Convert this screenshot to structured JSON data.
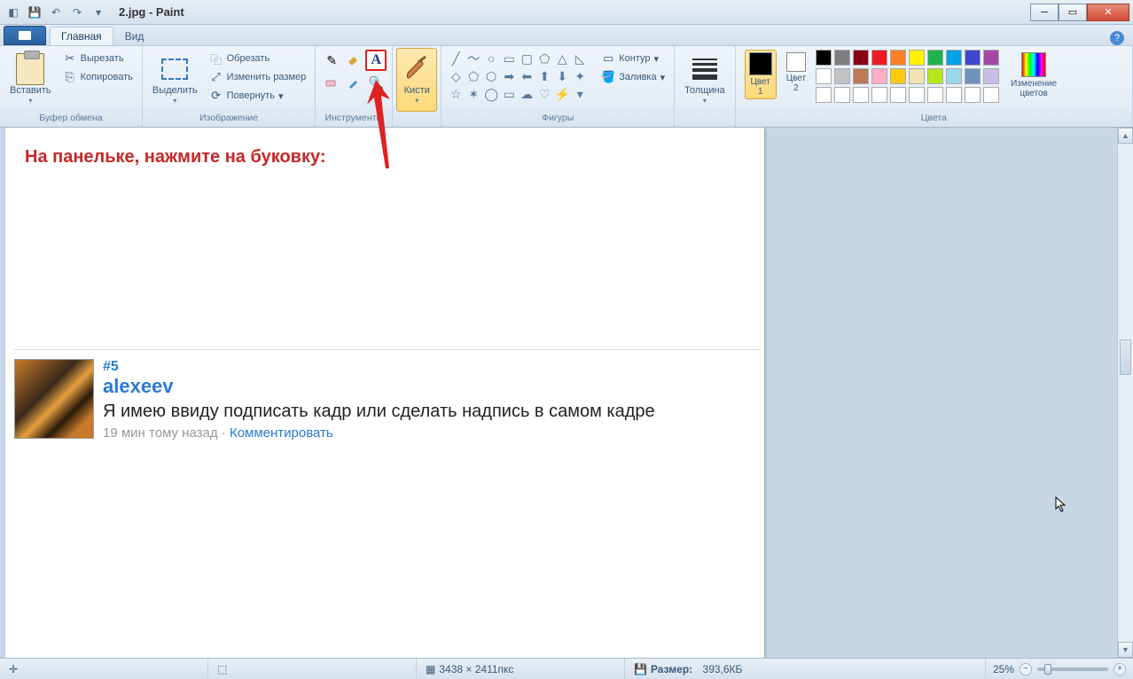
{
  "title": {
    "filename": "2.jpg",
    "app": "Paint"
  },
  "tabs": {
    "home": "Главная",
    "view": "Вид"
  },
  "ribbon": {
    "clipboard": {
      "paste": "Вставить",
      "cut": "Вырезать",
      "copy": "Копировать",
      "label": "Буфер обмена"
    },
    "image": {
      "select": "Выделить",
      "crop": "Обрезать",
      "resize": "Изменить размер",
      "rotate": "Повернуть",
      "label": "Изображение"
    },
    "tools": {
      "label": "Инструменты"
    },
    "brushes": {
      "label": "Кисти"
    },
    "shapes": {
      "outline": "Контур",
      "fill": "Заливка",
      "label": "Фигуры"
    },
    "thickness": {
      "label": "Толщина"
    },
    "colors": {
      "color1": "Цвет\n1",
      "color2": "Цвет\n2",
      "edit": "Изменение\nцветов",
      "label": "Цвета"
    }
  },
  "palette_row1": [
    "#000000",
    "#7f7f7f",
    "#880015",
    "#ed1c24",
    "#ff7f27",
    "#fff200",
    "#22b14c",
    "#00a2e8",
    "#3f48cc",
    "#a349a4"
  ],
  "palette_row2": [
    "#ffffff",
    "#c3c3c3",
    "#b97a57",
    "#ffaec9",
    "#ffc90e",
    "#efe4b0",
    "#b5e61d",
    "#99d9ea",
    "#7092be",
    "#c8bfe7"
  ],
  "palette_row3": [
    "#ffffff",
    "#ffffff",
    "#ffffff",
    "#ffffff",
    "#ffffff",
    "#ffffff",
    "#ffffff",
    "#ffffff",
    "#ffffff",
    "#ffffff"
  ],
  "canvas": {
    "instruction": "На панельке, нажмите на буковку:",
    "comment": {
      "number": "#5",
      "user": "alexeev",
      "text": "Я имею ввиду подписать кадр или сделать надпись в самом кадре",
      "time": "19 мин тому назад",
      "sep": " · ",
      "link": "Комментировать"
    }
  },
  "status": {
    "dimensions": "3438 × 2411пкс",
    "size_label": "Размер:",
    "size_value": "393,6КБ",
    "zoom": "25%"
  }
}
